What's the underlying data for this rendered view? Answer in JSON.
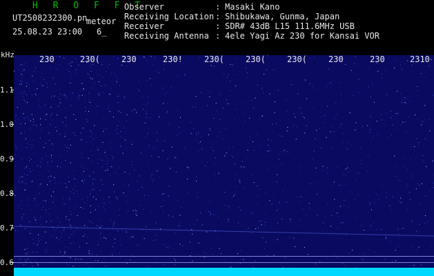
{
  "header": {
    "brand": "H R O F F T",
    "file_name": "UT2508232300.pn",
    "event_tag": "meteor",
    "datetime": "25.08.23 23:00",
    "count": "6_"
  },
  "info": {
    "rows": [
      {
        "key": "Observer",
        "sep": ":",
        "value": "Masaki Kano"
      },
      {
        "key": "Receiving Location",
        "sep": ":",
        "value": "Shibukawa, Gunma, Japan"
      },
      {
        "key": "Receiver",
        "sep": ":",
        "value": "SDR# 43dB L15 111.6MHz USB"
      },
      {
        "key": "Receiving Antenna",
        "sep": ":",
        "value": "4ele Yagi Az 230 for Kansai VOR"
      }
    ]
  },
  "axis": {
    "unit": "kHz",
    "top_ticks": [
      "230",
      "230(",
      "230",
      "230!",
      "230(",
      "230(",
      "230(",
      "230",
      "230",
      "2310"
    ],
    "y_ticks": [
      "1.1",
      "1.0",
      "0.9",
      "0.8",
      "0.7",
      "0.6"
    ]
  },
  "colors": {
    "background": "#000000",
    "spectrogram": "#0a0a60",
    "noise_band": "#00d8ff",
    "brand_green": "#00c000",
    "text": "#e8e8e8"
  }
}
